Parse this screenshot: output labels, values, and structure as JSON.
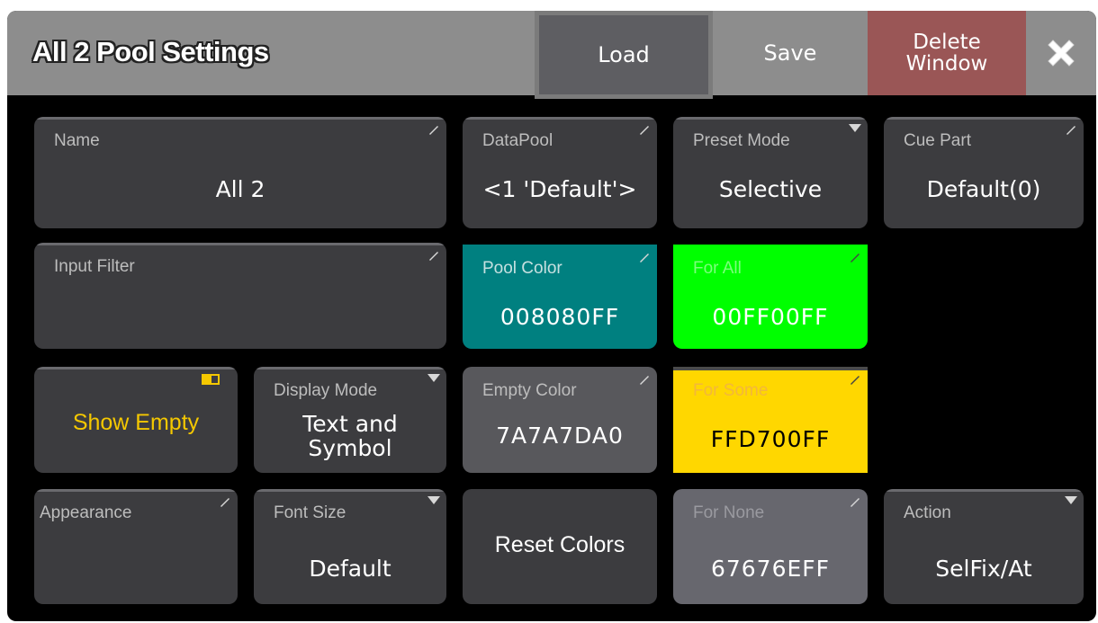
{
  "window": {
    "title": "All 2 Pool Settings",
    "load_label": "Load",
    "save_label": "Save",
    "delete_label_line1": "Delete",
    "delete_label_line2": "Window"
  },
  "fields": {
    "name": {
      "label": "Name",
      "value": "All 2"
    },
    "datapool": {
      "label": "DataPool",
      "value": "<1 'Default'>"
    },
    "preset_mode": {
      "label": "Preset Mode",
      "value": "Selective"
    },
    "cue_part": {
      "label": "Cue Part",
      "value": "Default(0)"
    },
    "input_filter": {
      "label": "Input Filter",
      "value": ""
    },
    "pool_color": {
      "label": "Pool Color",
      "value": "008080FF",
      "color": "#008080"
    },
    "for_all": {
      "label": "For All",
      "value": "00FF00FF",
      "color": "#00ff00"
    },
    "show_empty": {
      "label": "Show Empty",
      "color": "#f5c800"
    },
    "display_mode": {
      "label": "Display Mode",
      "value_line1": "Text and",
      "value_line2": "Symbol"
    },
    "empty_color": {
      "label": "Empty Color",
      "value": "7A7A7DA0",
      "color": "#58585c"
    },
    "for_some": {
      "label": "For Some",
      "value": "FFD700FF",
      "color": "#ffd700"
    },
    "appearance": {
      "label": "Appearance"
    },
    "font_size": {
      "label": "Font Size",
      "value": "Default"
    },
    "reset_colors": {
      "label": "Reset Colors"
    },
    "for_none": {
      "label": "For None",
      "value": "67676EFF",
      "color": "#67676e"
    },
    "action": {
      "label": "Action",
      "value": "SelFix/At"
    }
  }
}
